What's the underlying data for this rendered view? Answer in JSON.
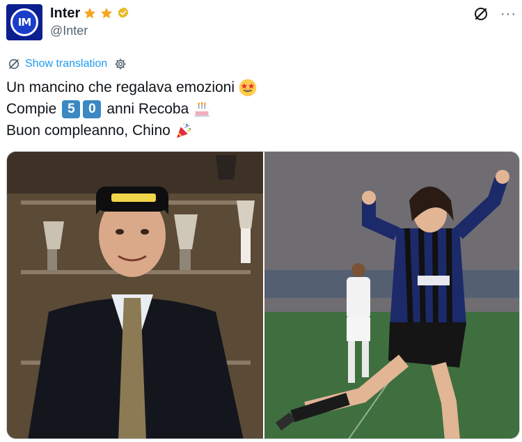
{
  "account": {
    "display_name": "Inter",
    "handle": "@Inter",
    "avatar_icon": "inter-logo-icon",
    "avatar_letters": "IM",
    "brand_color": "#0b1f8f",
    "badges": [
      "star-icon",
      "star-icon",
      "verified-badge-icon"
    ]
  },
  "header_actions": {
    "grok_icon": "grok-icon",
    "more_label": "···"
  },
  "translation": {
    "link_label": "Show translation",
    "link_color": "#1d9bf0"
  },
  "tweet": {
    "line1_text": "Un mancino che regalava emozioni",
    "line1_emoji": "star-struck-emoji",
    "line2_prefix": "Compie",
    "line2_digit1": "5",
    "line2_digit2": "0",
    "line2_suffix": "anni Recoba",
    "line2_emoji": "birthday-cake-emoji",
    "line3_text": "Buon compleanno, Chino",
    "line3_emoji": "party-popper-emoji"
  },
  "media": {
    "photos": [
      {
        "subject": "man in suit with Pirelli cap in front of trophy cabinet"
      },
      {
        "subject": "Inter player celebrating on pitch"
      }
    ]
  }
}
